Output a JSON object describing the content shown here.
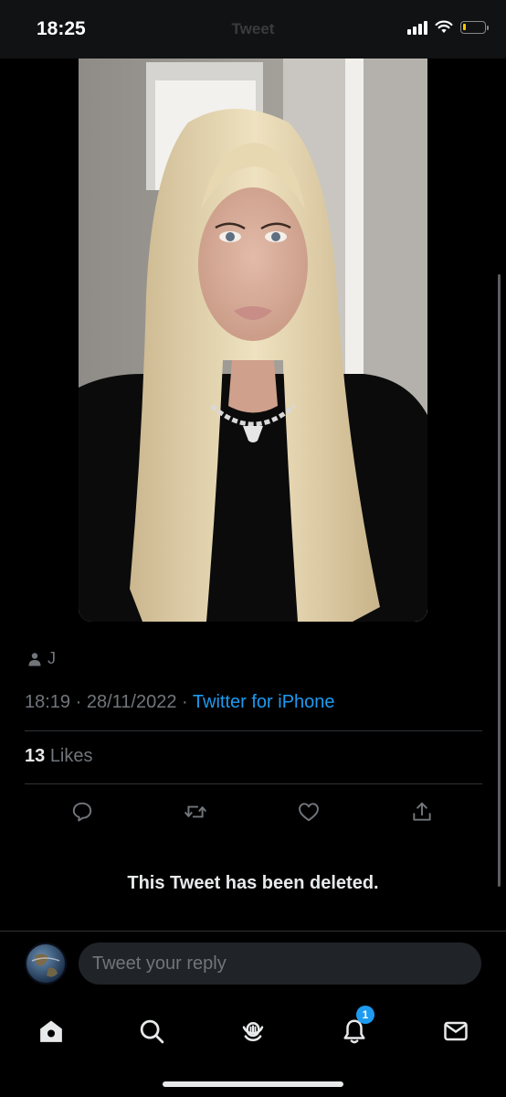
{
  "status_bar": {
    "time": "18:25",
    "title": "Tweet",
    "battery_level": 0.15,
    "signal_bars": 4
  },
  "media": {
    "description_icon": "photo",
    "colors": {
      "wall": "#9a9792",
      "door": "#dedcd8",
      "hair": "#e4d2a8",
      "shirt": "#0c0c0c",
      "skin": "#d6ab98"
    }
  },
  "tweet": {
    "author": "J",
    "author_icon": "person-icon",
    "time": "18:19",
    "separator": "·",
    "date": "28/11/2022",
    "source": "Twitter for iPhone",
    "likes_count": "13",
    "likes_label": "Likes"
  },
  "actions": [
    {
      "name": "reply",
      "icon": "comment-icon"
    },
    {
      "name": "retweet",
      "icon": "retweet-icon"
    },
    {
      "name": "like",
      "icon": "heart-icon"
    },
    {
      "name": "share",
      "icon": "share-icon"
    }
  ],
  "deleted_notice": "This Tweet has been deleted.",
  "reply": {
    "placeholder": "Tweet your reply"
  },
  "tab_bar": {
    "tabs": [
      "home",
      "search",
      "spaces",
      "notifications",
      "messages"
    ],
    "notification_badge": "1"
  },
  "accent_color": "#1d9bf0"
}
